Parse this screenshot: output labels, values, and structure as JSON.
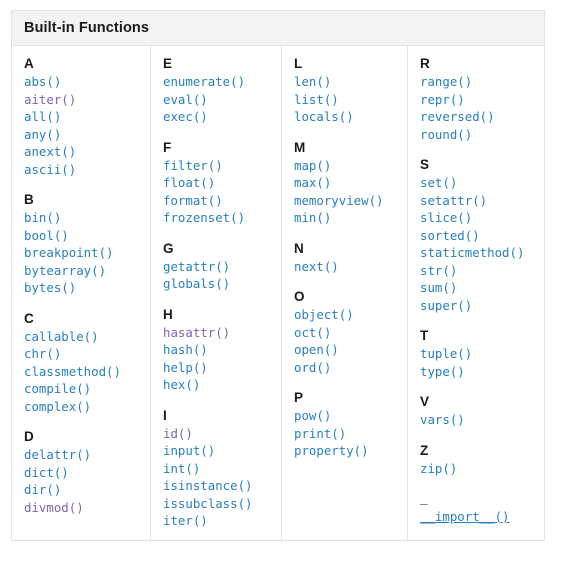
{
  "table": {
    "caption": "Built-in Functions",
    "colors": {
      "link": "#2980b9",
      "visited_link": "#7c65b0",
      "caption_background": "#f3f3f3",
      "border": "#e1e4e5",
      "heading_text": "#1a1a1a",
      "page_background": "#ffffff"
    },
    "columns": [
      {
        "id": "col-a-b-c-d",
        "groups": [
          {
            "letter": "A",
            "functions": [
              {
                "label": "abs()",
                "visited": false
              },
              {
                "label": "aiter()",
                "visited": true
              },
              {
                "label": "all()",
                "visited": false
              },
              {
                "label": "any()",
                "visited": false
              },
              {
                "label": "anext()",
                "visited": false
              },
              {
                "label": "ascii()",
                "visited": false
              }
            ]
          },
          {
            "letter": "B",
            "functions": [
              {
                "label": "bin()",
                "visited": false
              },
              {
                "label": "bool()",
                "visited": false
              },
              {
                "label": "breakpoint()",
                "visited": false
              },
              {
                "label": "bytearray()",
                "visited": false
              },
              {
                "label": "bytes()",
                "visited": false
              }
            ]
          },
          {
            "letter": "C",
            "functions": [
              {
                "label": "callable()",
                "visited": false
              },
              {
                "label": "chr()",
                "visited": false
              },
              {
                "label": "classmethod()",
                "visited": false
              },
              {
                "label": "compile()",
                "visited": false
              },
              {
                "label": "complex()",
                "visited": false
              }
            ]
          },
          {
            "letter": "D",
            "functions": [
              {
                "label": "delattr()",
                "visited": false
              },
              {
                "label": "dict()",
                "visited": false
              },
              {
                "label": "dir()",
                "visited": false
              },
              {
                "label": "divmod()",
                "visited": true
              }
            ]
          }
        ]
      },
      {
        "id": "col-e-f-g-h-i",
        "groups": [
          {
            "letter": "E",
            "functions": [
              {
                "label": "enumerate()",
                "visited": false
              },
              {
                "label": "eval()",
                "visited": false
              },
              {
                "label": "exec()",
                "visited": false
              }
            ]
          },
          {
            "letter": "F",
            "functions": [
              {
                "label": "filter()",
                "visited": false
              },
              {
                "label": "float()",
                "visited": false
              },
              {
                "label": "format()",
                "visited": false
              },
              {
                "label": "frozenset()",
                "visited": false
              }
            ]
          },
          {
            "letter": "G",
            "functions": [
              {
                "label": "getattr()",
                "visited": false
              },
              {
                "label": "globals()",
                "visited": false
              }
            ]
          },
          {
            "letter": "H",
            "functions": [
              {
                "label": "hasattr()",
                "visited": true
              },
              {
                "label": "hash()",
                "visited": false
              },
              {
                "label": "help()",
                "visited": false
              },
              {
                "label": "hex()",
                "visited": false
              }
            ]
          },
          {
            "letter": "I",
            "functions": [
              {
                "label": "id()",
                "visited": true
              },
              {
                "label": "input()",
                "visited": false
              },
              {
                "label": "int()",
                "visited": false
              },
              {
                "label": "isinstance()",
                "visited": false
              },
              {
                "label": "issubclass()",
                "visited": false
              },
              {
                "label": "iter()",
                "visited": false
              }
            ]
          }
        ]
      },
      {
        "id": "col-l-m-n-o-p",
        "groups": [
          {
            "letter": "L",
            "functions": [
              {
                "label": "len()",
                "visited": false
              },
              {
                "label": "list()",
                "visited": false
              },
              {
                "label": "locals()",
                "visited": false
              }
            ]
          },
          {
            "letter": "M",
            "functions": [
              {
                "label": "map()",
                "visited": false
              },
              {
                "label": "max()",
                "visited": false
              },
              {
                "label": "memoryview()",
                "visited": false
              },
              {
                "label": "min()",
                "visited": false
              }
            ]
          },
          {
            "letter": "N",
            "functions": [
              {
                "label": "next()",
                "visited": false
              }
            ]
          },
          {
            "letter": "O",
            "functions": [
              {
                "label": "object()",
                "visited": false
              },
              {
                "label": "oct()",
                "visited": false
              },
              {
                "label": "open()",
                "visited": false
              },
              {
                "label": "ord()",
                "visited": false
              }
            ]
          },
          {
            "letter": "P",
            "functions": [
              {
                "label": "pow()",
                "visited": false
              },
              {
                "label": "print()",
                "visited": false
              },
              {
                "label": "property()",
                "visited": false
              }
            ]
          }
        ]
      },
      {
        "id": "col-r-s-t-v-z-underscore",
        "groups": [
          {
            "letter": "R",
            "functions": [
              {
                "label": "range()",
                "visited": false
              },
              {
                "label": "repr()",
                "visited": false
              },
              {
                "label": "reversed()",
                "visited": false
              },
              {
                "label": "round()",
                "visited": false
              }
            ]
          },
          {
            "letter": "S",
            "functions": [
              {
                "label": "set()",
                "visited": false
              },
              {
                "label": "setattr()",
                "visited": false
              },
              {
                "label": "slice()",
                "visited": false
              },
              {
                "label": "sorted()",
                "visited": false
              },
              {
                "label": "staticmethod()",
                "visited": false
              },
              {
                "label": "str()",
                "visited": false
              },
              {
                "label": "sum()",
                "visited": false
              },
              {
                "label": "super()",
                "visited": false
              }
            ]
          },
          {
            "letter": "T",
            "functions": [
              {
                "label": "tuple()",
                "visited": false
              },
              {
                "label": "type()",
                "visited": false
              }
            ]
          },
          {
            "letter": "V",
            "functions": [
              {
                "label": "vars()",
                "visited": false
              }
            ]
          },
          {
            "letter": "Z",
            "functions": [
              {
                "label": "zip()",
                "visited": false
              }
            ]
          },
          {
            "letter": "_",
            "functions": [
              {
                "label": "__import__()",
                "visited": false,
                "underlined": true
              }
            ]
          }
        ]
      }
    ]
  }
}
